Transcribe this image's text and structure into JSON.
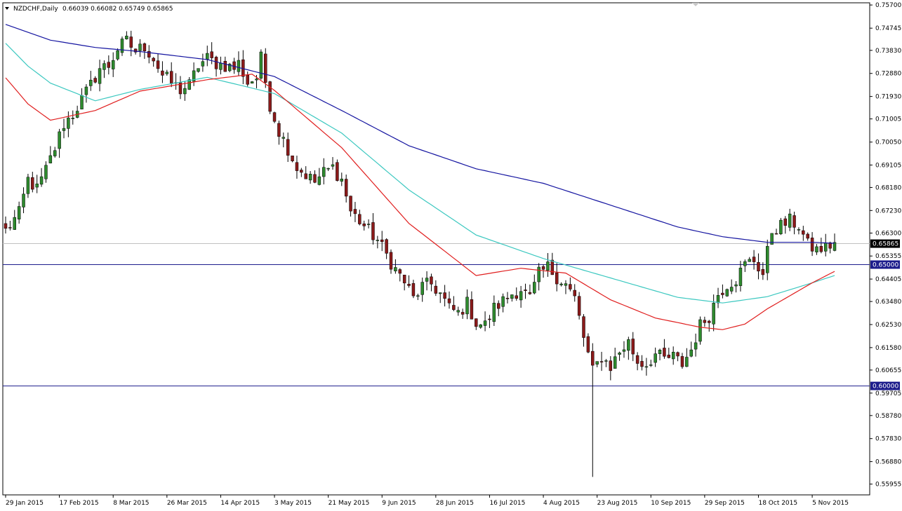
{
  "header": {
    "symbol": "NZDCHF,Daily",
    "ohlc": "0.66039 0.66082 0.65749 0.65865"
  },
  "colors": {
    "background": "#ffffff",
    "frame": "#000000",
    "bull": "#2e8b2e",
    "bear": "#8b1a1a",
    "wick": "#000000",
    "ma_blue": "#1414a0",
    "ma_cyan": "#3cc8c0",
    "ma_red": "#e01e1e",
    "hline": "#1c1c8c",
    "price_line": "#c0c0c0"
  },
  "chart_data": {
    "type": "candlestick",
    "symbol": "NZDCHF",
    "timeframe": "Daily",
    "ylim": [
      0.5551,
      0.7579
    ],
    "y_ticks": [
      "0.75700",
      "0.74745",
      "0.73830",
      "0.72880",
      "0.71930",
      "0.71005",
      "0.70050",
      "0.69105",
      "0.68180",
      "0.67230",
      "0.66300",
      "0.65355",
      "0.64405",
      "0.63480",
      "0.62530",
      "0.61580",
      "0.60655",
      "0.59705",
      "0.58780",
      "0.57830",
      "0.56880",
      "0.55955"
    ],
    "x_ticks": [
      "29 Jan 2015",
      "17 Feb 2015",
      "8 Mar 2015",
      "26 Mar 2015",
      "14 Apr 2015",
      "3 May 2015",
      "21 May 2015",
      "9 Jun 2015",
      "28 Jun 2015",
      "16 Jul 2015",
      "4 Aug 2015",
      "23 Aug 2015",
      "10 Sep 2015",
      "29 Sep 2015",
      "18 Oct 2015",
      "5 Nov 2015"
    ],
    "levels": [
      {
        "value": 0.65,
        "label": "0.65000"
      },
      {
        "value": 0.6,
        "label": "0.60000"
      }
    ],
    "current_price": {
      "value": 0.65865,
      "label": "0.65865"
    },
    "close_path": [
      [
        0,
        0.664
      ],
      [
        3,
        0.671
      ],
      [
        5,
        0.685
      ],
      [
        7,
        0.681
      ],
      [
        9,
        0.689
      ],
      [
        11,
        0.698
      ],
      [
        13,
        0.708
      ],
      [
        15,
        0.712
      ],
      [
        17,
        0.718
      ],
      [
        19,
        0.724
      ],
      [
        21,
        0.731
      ],
      [
        23,
        0.732
      ],
      [
        25,
        0.739
      ],
      [
        27,
        0.742
      ],
      [
        29,
        0.738
      ],
      [
        31,
        0.74
      ],
      [
        33,
        0.735
      ],
      [
        35,
        0.728
      ],
      [
        37,
        0.725
      ],
      [
        39,
        0.722
      ],
      [
        41,
        0.724
      ],
      [
        43,
        0.732
      ],
      [
        45,
        0.735
      ],
      [
        47,
        0.733
      ],
      [
        49,
        0.732
      ],
      [
        51,
        0.731
      ],
      [
        52,
        0.733
      ],
      [
        54,
        0.725
      ],
      [
        56,
        0.727
      ],
      [
        57,
        0.735
      ],
      [
        59,
        0.716
      ],
      [
        61,
        0.705
      ],
      [
        63,
        0.698
      ],
      [
        65,
        0.69
      ],
      [
        67,
        0.687
      ],
      [
        69,
        0.684
      ],
      [
        71,
        0.688
      ],
      [
        73,
        0.69
      ],
      [
        75,
        0.685
      ],
      [
        77,
        0.672
      ],
      [
        79,
        0.668
      ],
      [
        81,
        0.664
      ],
      [
        83,
        0.66
      ],
      [
        85,
        0.654
      ],
      [
        87,
        0.648
      ],
      [
        89,
        0.643
      ],
      [
        91,
        0.636
      ],
      [
        93,
        0.641
      ],
      [
        95,
        0.642
      ],
      [
        97,
        0.638
      ],
      [
        99,
        0.632
      ],
      [
        101,
        0.63
      ],
      [
        103,
        0.634
      ],
      [
        105,
        0.626
      ],
      [
        107,
        0.625
      ],
      [
        109,
        0.632
      ],
      [
        111,
        0.635
      ],
      [
        113,
        0.638
      ],
      [
        115,
        0.64
      ],
      [
        117,
        0.636
      ],
      [
        119,
        0.646
      ],
      [
        121,
        0.649
      ],
      [
        123,
        0.645
      ],
      [
        125,
        0.642
      ],
      [
        127,
        0.636
      ],
      [
        129,
        0.62
      ],
      [
        131,
        0.606
      ],
      [
        133,
        0.612
      ],
      [
        135,
        0.608
      ],
      [
        137,
        0.614
      ],
      [
        139,
        0.618
      ],
      [
        141,
        0.61
      ],
      [
        143,
        0.609
      ],
      [
        145,
        0.613
      ],
      [
        147,
        0.611
      ],
      [
        149,
        0.612
      ],
      [
        151,
        0.609
      ],
      [
        153,
        0.615
      ],
      [
        155,
        0.625
      ],
      [
        157,
        0.629
      ],
      [
        159,
        0.638
      ],
      [
        161,
        0.642
      ],
      [
        163,
        0.644
      ],
      [
        165,
        0.65
      ],
      [
        167,
        0.652
      ],
      [
        169,
        0.646
      ],
      [
        171,
        0.664
      ],
      [
        173,
        0.666
      ],
      [
        175,
        0.668
      ],
      [
        177,
        0.666
      ],
      [
        179,
        0.658
      ],
      [
        181,
        0.656
      ],
      [
        183,
        0.657
      ],
      [
        185,
        0.659
      ]
    ],
    "series": [
      {
        "values": [
          [
            0,
            0.749
          ],
          [
            10,
            0.7425
          ],
          [
            20,
            0.7395
          ],
          [
            30,
            0.7378
          ],
          [
            45,
            0.7345
          ],
          [
            60,
            0.7275
          ],
          [
            75,
            0.7135
          ],
          [
            90,
            0.699
          ],
          [
            105,
            0.6895
          ],
          [
            120,
            0.6835
          ],
          [
            135,
            0.6745
          ],
          [
            150,
            0.6655
          ],
          [
            160,
            0.6615
          ],
          [
            170,
            0.6592
          ],
          [
            180,
            0.6592
          ],
          [
            185,
            0.6588
          ]
        ]
      },
      {
        "values": [
          [
            0,
            0.7412
          ],
          [
            5,
            0.7318
          ],
          [
            10,
            0.7248
          ],
          [
            20,
            0.7175
          ],
          [
            30,
            0.7222
          ],
          [
            45,
            0.7272
          ],
          [
            60,
            0.7205
          ],
          [
            75,
            0.7042
          ],
          [
            90,
            0.6808
          ],
          [
            105,
            0.6622
          ],
          [
            120,
            0.6525
          ],
          [
            135,
            0.6445
          ],
          [
            150,
            0.6365
          ],
          [
            160,
            0.6342
          ],
          [
            170,
            0.6368
          ],
          [
            180,
            0.6425
          ],
          [
            185,
            0.6455
          ]
        ]
      },
      {
        "values": [
          [
            0,
            0.727
          ],
          [
            5,
            0.7162
          ],
          [
            10,
            0.7095
          ],
          [
            20,
            0.7135
          ],
          [
            30,
            0.7215
          ],
          [
            45,
            0.7262
          ],
          [
            55,
            0.7285
          ],
          [
            60,
            0.7218
          ],
          [
            75,
            0.6982
          ],
          [
            90,
            0.667
          ],
          [
            105,
            0.6455
          ],
          [
            115,
            0.6485
          ],
          [
            125,
            0.6465
          ],
          [
            135,
            0.6355
          ],
          [
            145,
            0.628
          ],
          [
            155,
            0.6242
          ],
          [
            160,
            0.6232
          ],
          [
            165,
            0.6255
          ],
          [
            170,
            0.6318
          ],
          [
            180,
            0.6425
          ],
          [
            185,
            0.6472
          ]
        ]
      }
    ]
  }
}
